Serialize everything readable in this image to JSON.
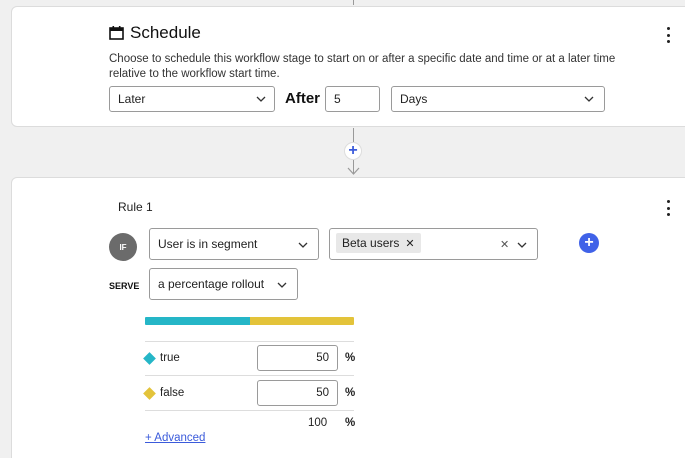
{
  "schedule": {
    "title": "Schedule",
    "description": "Choose to schedule this workflow stage to start on or after a specific date and time or at a later time relative to the workflow start time.",
    "timing_select": "Later",
    "after_label": "After",
    "amount_value": "5",
    "unit_select": "Days"
  },
  "connector": {
    "add_label": "+"
  },
  "rule": {
    "label": "Rule 1",
    "if_badge": "IF",
    "condition_select": "User is in segment",
    "segment_chip": "Beta users",
    "chip_remove": "✕",
    "clear_glyph": "✕",
    "add_clause_label": "+",
    "serve_label": "SERVE",
    "serve_select": "a percentage rollout",
    "rollout": {
      "variations": [
        {
          "name": "true",
          "percent": "50",
          "color": "#25b6c7"
        },
        {
          "name": "false",
          "percent": "50",
          "color": "#e3c33a"
        }
      ],
      "percent_sign": "%",
      "total": "100",
      "advanced_link": "+ Advanced"
    }
  },
  "colors": {
    "accent": "#4062e8",
    "true_color": "#25b6c7",
    "false_color": "#e3c33a"
  }
}
